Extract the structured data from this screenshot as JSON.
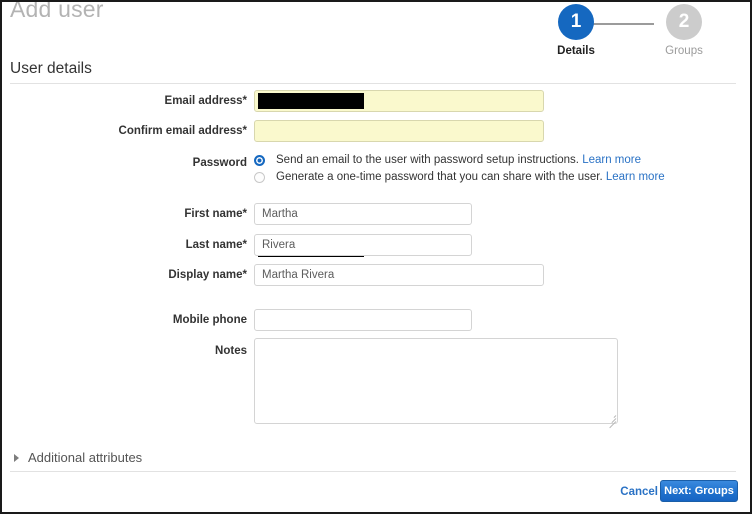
{
  "window": {
    "title": "Add user"
  },
  "wizard": {
    "steps": [
      {
        "number": "1",
        "label": "Details",
        "state": "active"
      },
      {
        "number": "2",
        "label": "Groups",
        "state": "inactive"
      }
    ]
  },
  "section": {
    "title": "User details"
  },
  "form": {
    "email": {
      "label": "Email address*",
      "value": "",
      "placeholder": "",
      "redacted": true,
      "autofilled": true
    },
    "confirm_email": {
      "label": "Confirm email address*",
      "value": "",
      "placeholder": "",
      "redacted": true,
      "autofilled": true
    },
    "password": {
      "label": "Password",
      "options": [
        {
          "text": "Send an email to the user with password setup instructions.",
          "link": "Learn more",
          "selected": true
        },
        {
          "text": "Generate a one-time password that you can share with the user.",
          "link": "Learn more",
          "selected": false
        }
      ]
    },
    "first_name": {
      "label": "First name*",
      "value": "Martha",
      "placeholder": ""
    },
    "last_name": {
      "label": "Last name*",
      "value": "Rivera",
      "placeholder": ""
    },
    "display_name": {
      "label": "Display name*",
      "value": "Martha Rivera",
      "placeholder": ""
    },
    "mobile_phone": {
      "label": "Mobile phone",
      "value": "",
      "placeholder": ""
    },
    "notes": {
      "label": "Notes",
      "value": "",
      "placeholder": ""
    }
  },
  "expander": {
    "label": "Additional attributes",
    "expanded": false,
    "icon": "triangle-right-icon"
  },
  "footer": {
    "cancel_label": "Cancel",
    "next_label": "Next: Groups"
  },
  "colors": {
    "accent_blue": "#1568c0",
    "link_blue": "#2a72c5",
    "autofill_yellow": "#faf9cd",
    "inactive_gray": "#cccccc",
    "title_gray": "#b3b3b3"
  }
}
